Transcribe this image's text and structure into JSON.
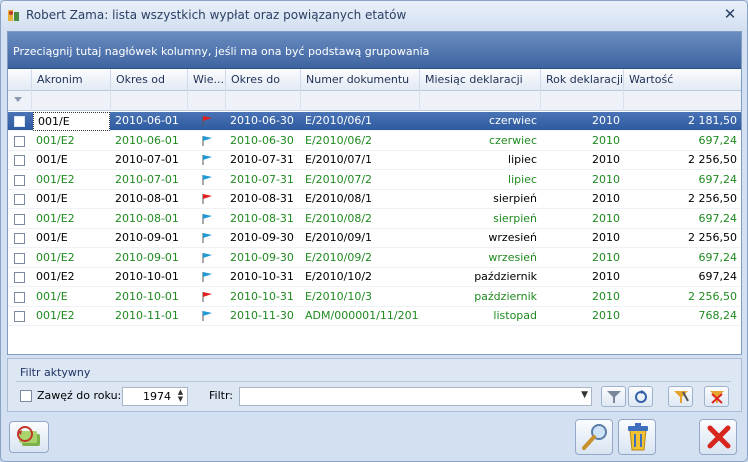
{
  "window": {
    "title": "Robert Zama: lista wszystkich wypłat oraz powiązanych etatów",
    "close_glyph": "✕"
  },
  "grid": {
    "group_hint": "Przeciągnij tutaj nagłówek kolumny, jeśli ma ona być podstawą grupowania",
    "columns": [
      "Akronim",
      "Okres od",
      "Wie...",
      "Okres do",
      "Numer dokumentu",
      "Miesiąc deklaracji",
      "Rok deklaracji",
      "Wartość"
    ],
    "rows": [
      {
        "akronim": "001/E",
        "od": "2010-06-01",
        "flag": "red",
        "do": "2010-06-30",
        "numer": "E/2010/06/1",
        "miesiac": "czerwiec",
        "rok": "2010",
        "wartosc": "2 181,50",
        "color": "black",
        "selected": true
      },
      {
        "akronim": "001/E2",
        "od": "2010-06-01",
        "flag": "blue",
        "do": "2010-06-30",
        "numer": "E/2010/06/2",
        "miesiac": "czerwiec",
        "rok": "2010",
        "wartosc": "697,24",
        "color": "green"
      },
      {
        "akronim": "001/E",
        "od": "2010-07-01",
        "flag": "blue",
        "do": "2010-07-31",
        "numer": "E/2010/07/1",
        "miesiac": "lipiec",
        "rok": "2010",
        "wartosc": "2 256,50",
        "color": "black"
      },
      {
        "akronim": "001/E2",
        "od": "2010-07-01",
        "flag": "blue",
        "do": "2010-07-31",
        "numer": "E/2010/07/2",
        "miesiac": "lipiec",
        "rok": "2010",
        "wartosc": "697,24",
        "color": "green"
      },
      {
        "akronim": "001/E",
        "od": "2010-08-01",
        "flag": "red",
        "do": "2010-08-31",
        "numer": "E/2010/08/1",
        "miesiac": "sierpień",
        "rok": "2010",
        "wartosc": "2 256,50",
        "color": "black"
      },
      {
        "akronim": "001/E2",
        "od": "2010-08-01",
        "flag": "blue",
        "do": "2010-08-31",
        "numer": "E/2010/08/2",
        "miesiac": "sierpień",
        "rok": "2010",
        "wartosc": "697,24",
        "color": "green"
      },
      {
        "akronim": "001/E",
        "od": "2010-09-01",
        "flag": "blue",
        "do": "2010-09-30",
        "numer": "E/2010/09/1",
        "miesiac": "wrzesień",
        "rok": "2010",
        "wartosc": "2 256,50",
        "color": "black"
      },
      {
        "akronim": "001/E2",
        "od": "2010-09-01",
        "flag": "blue",
        "do": "2010-09-30",
        "numer": "E/2010/09/2",
        "miesiac": "wrzesień",
        "rok": "2010",
        "wartosc": "697,24",
        "color": "green"
      },
      {
        "akronim": "001/E2",
        "od": "2010-10-01",
        "flag": "blue",
        "do": "2010-10-31",
        "numer": "E/2010/10/2",
        "miesiac": "październik",
        "rok": "2010",
        "wartosc": "697,24",
        "color": "black"
      },
      {
        "akronim": "001/E",
        "od": "2010-10-01",
        "flag": "red",
        "do": "2010-10-31",
        "numer": "E/2010/10/3",
        "miesiac": "październik",
        "rok": "2010",
        "wartosc": "2 256,50",
        "color": "green"
      },
      {
        "akronim": "001/E2",
        "od": "2010-11-01",
        "flag": "blue",
        "do": "2010-11-30",
        "numer": "ADM/000001/11/201...",
        "miesiac": "listopad",
        "rok": "2010",
        "wartosc": "768,24",
        "color": "green"
      }
    ]
  },
  "filter_panel": {
    "title": "Filtr aktywny",
    "zawez_label": "Zawęź do roku:",
    "year_value": "1974",
    "filter_label": "Filtr:",
    "filter_value": ""
  },
  "colors": {
    "green": "#1f8a1f",
    "accent": "#3e64a0"
  }
}
